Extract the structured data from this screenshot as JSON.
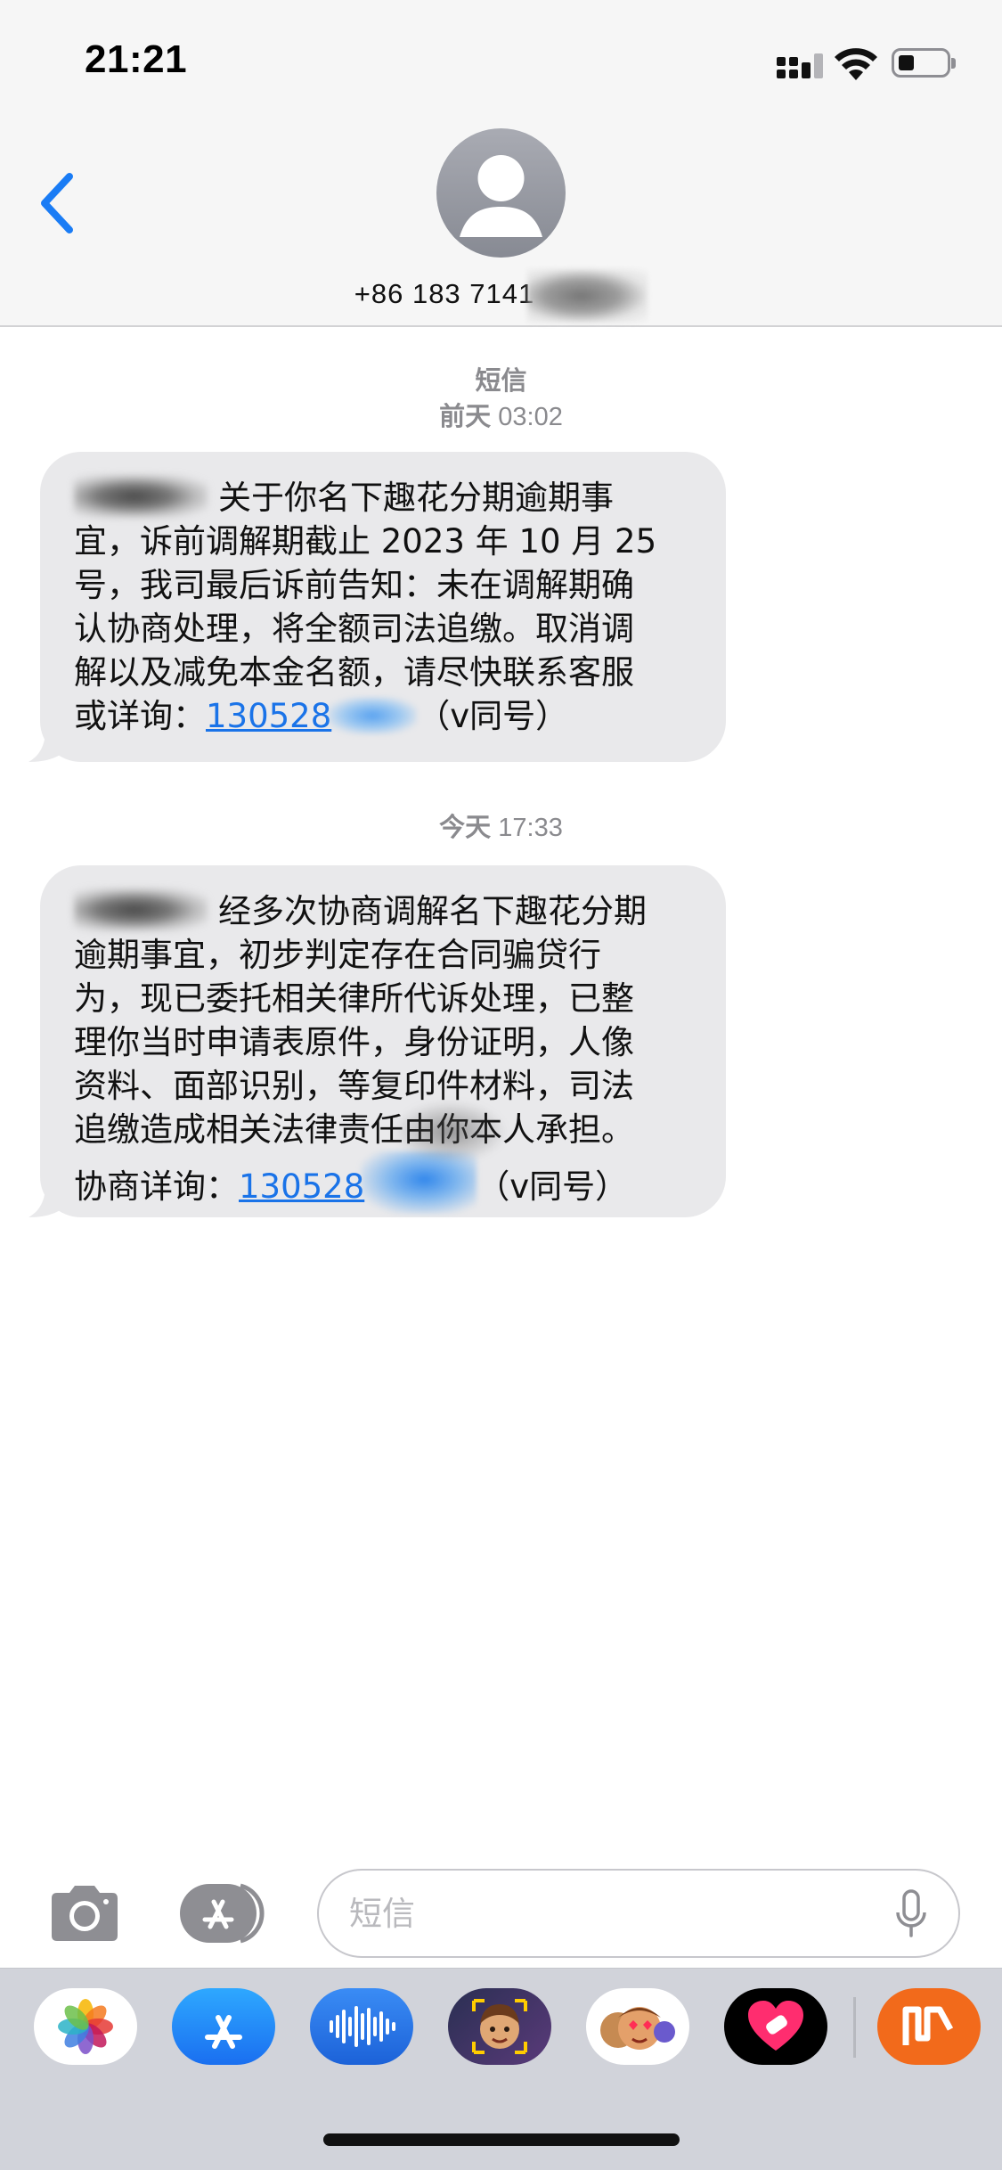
{
  "status_bar": {
    "time": "21:21"
  },
  "header": {
    "contact_number": "+86 183 7141"
  },
  "conversation": {
    "service_label": "短信",
    "messages": [
      {
        "day": "前天",
        "time": "03:02",
        "lines": [
          "关于你名下趣花分期逾期事",
          "宜，诉前调解期截止 2023 年 10 月 25",
          "号，我司最后诉前告知：未在调解期确",
          "认协商处理，将全额司法追缴。取消调",
          "解以及减免本金名额，请尽快联系客服"
        ],
        "last_prefix": "或详询：",
        "link_text": "130528",
        "last_suffix": "（v同号）"
      },
      {
        "day": "今天",
        "time": "17:33",
        "lines": [
          "经多次协商调解名下趣花分期",
          "逾期事宜，初步判定存在合同骗贷行",
          "为，现已委托相关律所代诉处理，已整",
          "理你当时申请表原件，身份证明，人像",
          "资料、面部识别，等复印件材料，司法",
          "追缴造成相关法律责任由你本人承担。"
        ],
        "last_prefix": "协商详询：",
        "link_text": "130528",
        "last_suffix": "（v同号）"
      }
    ]
  },
  "compose": {
    "placeholder": "短信"
  },
  "colors": {
    "link": "#1a73e8",
    "accent": "#1a7cf5",
    "bubble": "#e9e9eb"
  },
  "icons": [
    "back-chevron-icon",
    "camera-icon",
    "app-store-icon",
    "microphone-icon",
    "photos-app-icon",
    "audio-app-icon",
    "memoji-app-icon",
    "heart-app-icon",
    "mango-tv-app-icon"
  ]
}
